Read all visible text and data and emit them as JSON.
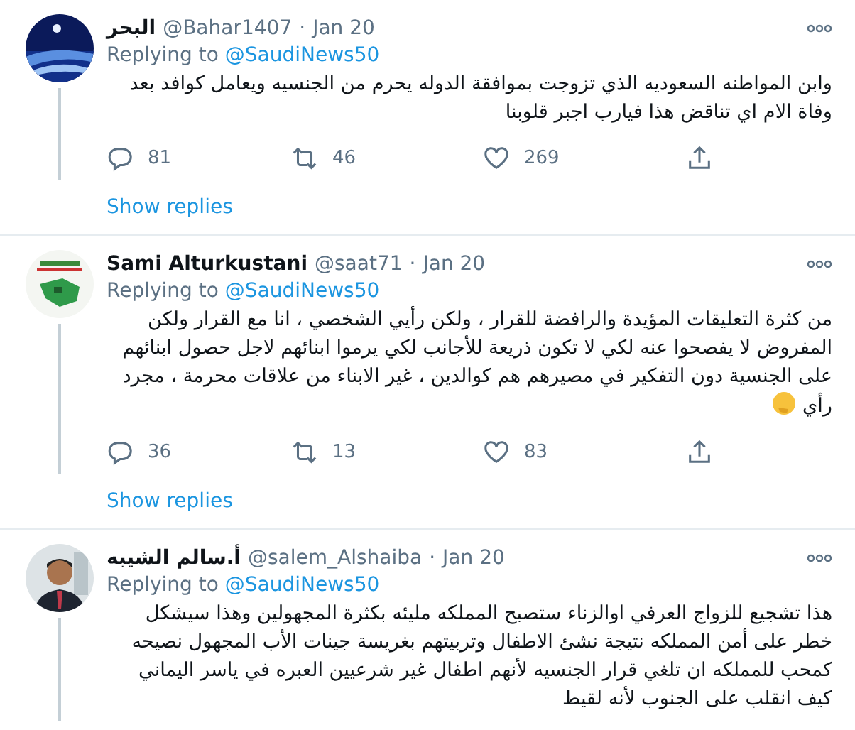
{
  "tweets": [
    {
      "name": "البحر",
      "handle": "@Bahar1407",
      "date": "Jan 20",
      "replying_label": "Replying to",
      "reply_to": "@SaudiNews50",
      "text": "وابن المواطنه السعوديه الذي تزوجت بموافقة الدوله  يحرم من الجنسيه ويعامل كوافد بعد وفاة الام اي تناقض هذا فيارب اجبر قلوبنا",
      "separator": "·",
      "emoji": false,
      "actions": {
        "replies": "81",
        "retweets": "46",
        "likes": "269"
      },
      "show_replies": "Show replies"
    },
    {
      "name": "Sami Alturkustani",
      "handle": "@saat71",
      "date": "Jan 20",
      "replying_label": "Replying to",
      "reply_to": "@SaudiNews50",
      "text": "من كثرة التعليقات المؤيدة والرافضة للقرار ، ولكن رأيي الشخصي ، انا مع القرار ولكن المفروض لا يفصحوا عنه لكي لا تكون ذريعة للأجانب لكي يرموا ابنائهم لاجل حصول ابنائهم على الجنسية دون التفكير في مصيرهم هم كوالدين ، غير الابناء من علاقات محرمة ، مجرد رأي",
      "separator": "·",
      "emoji": true,
      "actions": {
        "replies": "36",
        "retweets": "13",
        "likes": "83"
      },
      "show_replies": "Show replies"
    },
    {
      "name": "أ.سالم الشيبه",
      "handle": "@salem_Alshaiba",
      "date": "Jan 20",
      "replying_label": "Replying to",
      "reply_to": "@SaudiNews50",
      "text": "هذا تشجيع للزواج العرفي اوالزناء ستصبح المملكه مليئه بكثرة المجهولين وهذا سيشكل خطر على أمن المملكه نتيجة نشئ الاطفال وتربيتهم بغريسة جينات الأب المجهول نصيحه كمحب للمملكه ان تلغي قرار الجنسيه لأنهم اطفال غير شرعيين العبره في ياسر اليماني كيف انقلب على الجنوب لأنه لقيط",
      "separator": "·",
      "emoji": false
    }
  ]
}
